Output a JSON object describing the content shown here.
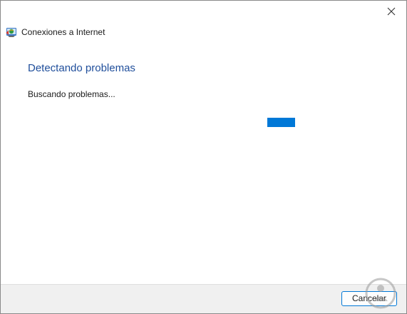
{
  "window": {
    "title": "Conexiones a Internet",
    "close_icon": "close-icon"
  },
  "content": {
    "heading": "Detectando problemas",
    "status": "Buscando problemas..."
  },
  "progress": {
    "type": "indeterminate",
    "color": "#0078d7"
  },
  "footer": {
    "cancel_label": "Cancelar"
  },
  "colors": {
    "heading": "#1f4e9b",
    "accent": "#0078d7",
    "footer_bg": "#f0f0f0"
  }
}
